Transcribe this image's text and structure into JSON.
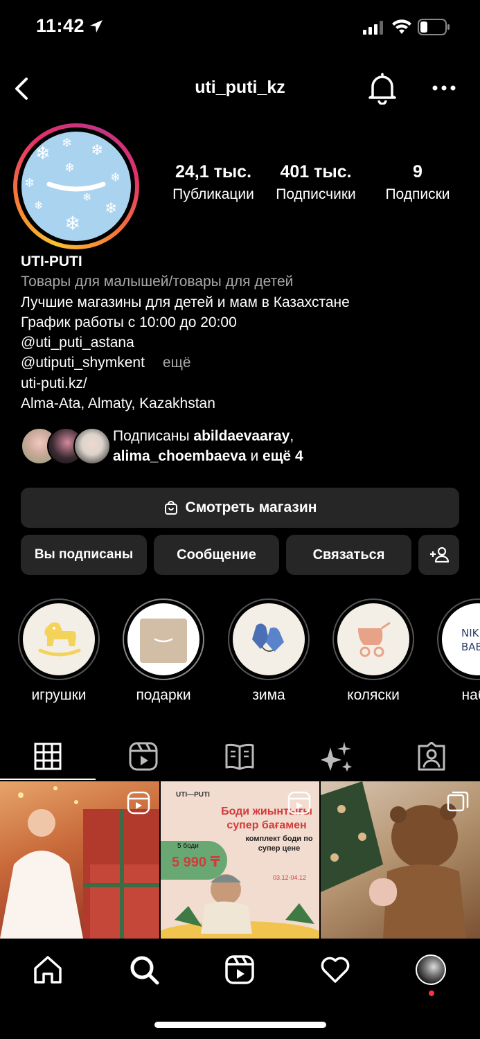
{
  "status_bar": {
    "time": "11:42"
  },
  "header": {
    "username": "uti_puti_kz"
  },
  "stats": [
    {
      "value": "24,1 тыс.",
      "label": "Публикации"
    },
    {
      "value": "401 тыс.",
      "label": "Подписчики"
    },
    {
      "value": "9",
      "label": "Подписки"
    }
  ],
  "bio": {
    "name": "UTI-PUTI",
    "category": "Товары для малышей/товары для детей",
    "line1": "Лучшие магазины для детей и мам в Казахстане",
    "line2": "График работы с 10:00 до 20:00",
    "line3": "@uti_puti_astana",
    "line4": "@utiputi_shymkent",
    "more": "ещё",
    "link": "uti-puti.kz/",
    "location": "Alma-Ata, Almaty, Kazakhstan"
  },
  "followed_by": {
    "prefix": "Подписаны",
    "user1": "abildaevaaray",
    "user2": "alima_choembaeva",
    "and": "и",
    "rest": "ещё 4"
  },
  "buttons": {
    "shop": "Смотреть магазин",
    "following": "Вы подписаны",
    "message": "Сообщение",
    "contact": "Связаться"
  },
  "highlights": [
    {
      "label": "игрушки",
      "icon": "rocking-horse-icon"
    },
    {
      "label": "подарки",
      "icon": "gift-box-icon"
    },
    {
      "label": "зима",
      "icon": "mittens-icon"
    },
    {
      "label": "коляски",
      "icon": "stroller-icon"
    },
    {
      "label": "набо",
      "icon": "nike-baby-icon",
      "logo_text": "NIK BAB"
    }
  ],
  "posts": [
    {
      "kind": "reel",
      "description_icon": "reel-icon"
    },
    {
      "kind": "reel",
      "brand": "UTI—PUTI",
      "headline": "Боди жиынтығы супер бағамен",
      "sub": "комплект боди по супер цене",
      "badge_top": "5 боди",
      "price": "5 990 ₸",
      "dates": "03.12-04.12"
    },
    {
      "kind": "carousel"
    }
  ],
  "colors": {
    "background": "#000000",
    "button": "#262626",
    "muted": "#a8a8a8",
    "notification": "#ff3040"
  }
}
